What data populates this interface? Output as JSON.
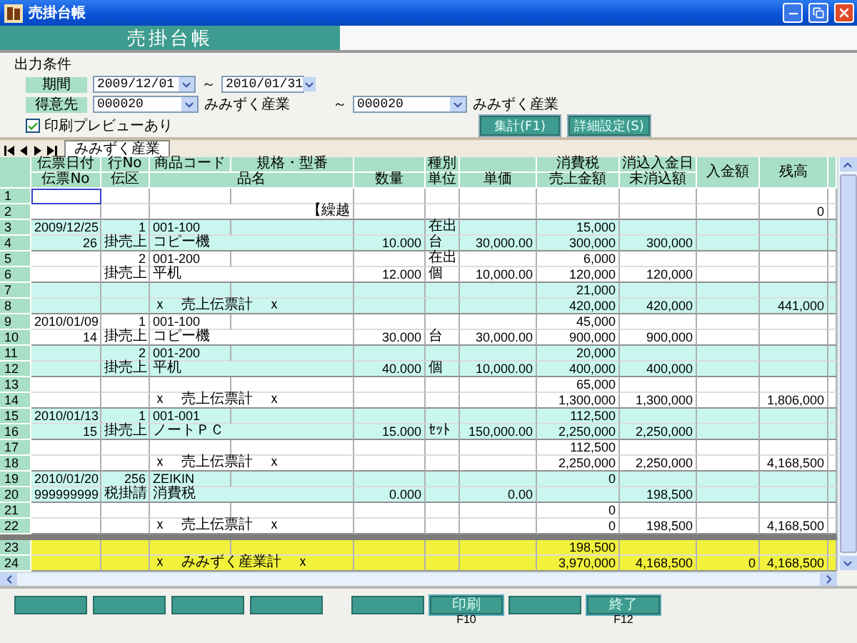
{
  "window": {
    "title": "売掛台帳"
  },
  "banner": {
    "title": "売掛台帳"
  },
  "conditions": {
    "heading": "出力条件",
    "period": {
      "label": "期間",
      "from": "2009/12/01",
      "separator": "～",
      "to": "2010/01/31"
    },
    "customer": {
      "label": "得意先",
      "from": "000020",
      "from_name": "みみずく産業",
      "separator": "～",
      "to": "000020",
      "to_name": "みみずく産業"
    },
    "preview": {
      "label": "印刷プレビューあり",
      "checked": true
    },
    "buttons": [
      "集計(F1)",
      "詳細設定(S)"
    ]
  },
  "sheet_tabs": [
    {
      "label": "みみずく産業",
      "selected": true
    }
  ],
  "table": {
    "header_cells": [
      "伝票日付",
      "行No",
      "商品コード",
      "規格・型番",
      "種別",
      "消費税",
      "消込入金日",
      "入金額",
      "残高",
      "伝票No",
      "伝区",
      "品名",
      "数量",
      "単位",
      "単価",
      "売上金額",
      "未消込額"
    ],
    "rows": [
      {
        "number": "1",
        "kind": "upper",
        "color": "#ffffff",
        "selected": true
      },
      {
        "number": "2",
        "kind": "lower",
        "color": "#ffffff",
        "selected": false,
        "carry_over": "【繰越",
        "balance": "0"
      },
      {
        "number": "3",
        "kind": "upper",
        "color": "#c9f7ef",
        "selected": false,
        "date": "2009/12/25",
        "line_no": "1",
        "product_code": "001-100",
        "type": "在出",
        "tax": "15,000"
      },
      {
        "number": "4",
        "kind": "lower",
        "color": "#c9f7ef",
        "selected": false,
        "slip_no": "26",
        "slip_class": "掛売上",
        "product_name": "コピー機",
        "qty": "10.000",
        "unit": "台",
        "unit_price": "30,000.00",
        "sales": "300,000",
        "uncleared": "300,000"
      },
      {
        "number": "5",
        "kind": "upper",
        "color": "#ffffff",
        "selected": false,
        "line_no": "2",
        "product_code": "001-200",
        "type": "在出",
        "tax": "6,000"
      },
      {
        "number": "6",
        "kind": "lower",
        "color": "#ffffff",
        "selected": false,
        "slip_class": "掛売上",
        "product_name": "平机",
        "qty": "12.000",
        "unit": "個",
        "unit_price": "10,000.00",
        "sales": "120,000",
        "uncleared": "120,000"
      },
      {
        "number": "7",
        "kind": "upper",
        "color": "#c9f7ef",
        "selected": false,
        "tax": "21,000"
      },
      {
        "number": "8",
        "kind": "lower",
        "color": "#c9f7ef",
        "selected": false,
        "product_name": "ｘ　売上伝票計　ｘ",
        "sales": "420,000",
        "uncleared": "420,000",
        "balance": "441,000"
      },
      {
        "number": "9",
        "kind": "upper",
        "color": "#ffffff",
        "selected": false,
        "date": "2010/01/09",
        "line_no": "1",
        "product_code": "001-100",
        "tax": "45,000"
      },
      {
        "number": "10",
        "kind": "lower",
        "color": "#ffffff",
        "selected": false,
        "slip_no": "14",
        "slip_class": "掛売上",
        "product_name": "コピー機",
        "qty": "30.000",
        "unit": "台",
        "unit_price": "30,000.00",
        "sales": "900,000",
        "uncleared": "900,000"
      },
      {
        "number": "11",
        "kind": "upper",
        "color": "#c9f7ef",
        "selected": false,
        "line_no": "2",
        "product_code": "001-200",
        "tax": "20,000"
      },
      {
        "number": "12",
        "kind": "lower",
        "color": "#c9f7ef",
        "selected": false,
        "slip_class": "掛売上",
        "product_name": "平机",
        "qty": "40.000",
        "unit": "個",
        "unit_price": "10,000.00",
        "sales": "400,000",
        "uncleared": "400,000"
      },
      {
        "number": "13",
        "kind": "upper",
        "color": "#ffffff",
        "selected": false,
        "tax": "65,000"
      },
      {
        "number": "14",
        "kind": "lower",
        "color": "#ffffff",
        "selected": false,
        "product_name": "ｘ　売上伝票計　ｘ",
        "sales": "1,300,000",
        "uncleared": "1,300,000",
        "balance": "1,806,000"
      },
      {
        "number": "15",
        "kind": "upper",
        "color": "#c9f7ef",
        "selected": false,
        "date": "2010/01/13",
        "line_no": "1",
        "product_code": "001-001",
        "tax": "112,500"
      },
      {
        "number": "16",
        "kind": "lower",
        "color": "#c9f7ef",
        "selected": false,
        "slip_no": "15",
        "slip_class": "掛売上",
        "product_name": "ノートＰＣ",
        "qty": "15.000",
        "unit": "ｾｯﾄ",
        "unit_price": "150,000.00",
        "sales": "2,250,000",
        "uncleared": "2,250,000"
      },
      {
        "number": "17",
        "kind": "upper",
        "color": "#ffffff",
        "selected": false,
        "tax": "112,500"
      },
      {
        "number": "18",
        "kind": "lower",
        "color": "#ffffff",
        "selected": false,
        "product_name": "ｘ　売上伝票計　ｘ",
        "sales": "2,250,000",
        "uncleared": "2,250,000",
        "balance": "4,168,500"
      },
      {
        "number": "19",
        "kind": "upper",
        "color": "#c9f7ef",
        "selected": false,
        "date": "2010/01/20",
        "line_no": "256",
        "product_code": "ZEIKIN",
        "tax": "0"
      },
      {
        "number": "20",
        "kind": "lower",
        "color": "#c9f7ef",
        "selected": false,
        "slip_no": "999999999",
        "slip_class": "税掛請",
        "product_name": "消費税",
        "qty": "0.000",
        "unit_price": "0.00",
        "uncleared": "198,500"
      },
      {
        "number": "21",
        "kind": "upper",
        "color": "#ffffff",
        "selected": false,
        "tax": "0"
      },
      {
        "number": "22",
        "kind": "lower",
        "color": "#ffffff",
        "selected": false,
        "product_name": "ｘ　売上伝票計　ｘ",
        "sales": "0",
        "uncleared": "198,500",
        "balance": "4,168,500"
      }
    ],
    "total_rows": [
      {
        "number": "23",
        "kind": "upper",
        "color": "#f2f23c",
        "selected": false,
        "tax": "198,500"
      },
      {
        "number": "24",
        "kind": "lower",
        "color": "#f2f23c",
        "selected": false,
        "product_name": "ｘ　みみずく産業計　ｘ",
        "sales": "3,970,000",
        "uncleared": "4,168,500",
        "paid": "0",
        "balance": "4,168,500"
      }
    ]
  },
  "function_buttons": {
    "left": [
      {
        "kind": "blank"
      },
      {
        "kind": "blank"
      },
      {
        "kind": "blank"
      },
      {
        "kind": "blank"
      }
    ],
    "right": [
      {
        "kind": "blank"
      },
      {
        "kind": "command",
        "label": "印刷",
        "key": "F10"
      },
      {
        "kind": "blank"
      },
      {
        "kind": "command",
        "label": "終了",
        "key": "F12"
      }
    ]
  }
}
